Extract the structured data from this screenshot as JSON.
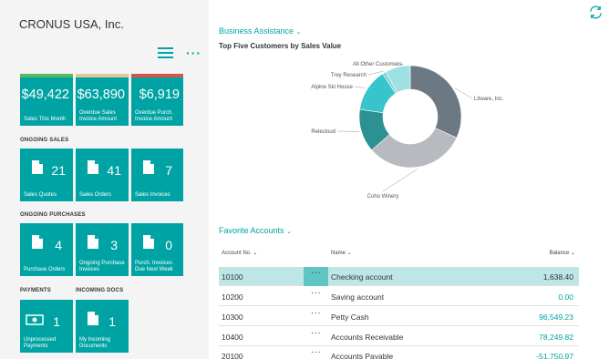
{
  "header": {
    "company": "CRONUS USA, Inc."
  },
  "kpi_tiles": [
    {
      "value": "$49,422",
      "caption": "Sales This Month",
      "bar_color": "#5cb85c"
    },
    {
      "value": "$63,890",
      "caption": "Overdue Sales Invoice Amount",
      "bar_color": "#e2c792"
    },
    {
      "value": "$6,919",
      "caption": "Overdue Purch. Invoice Amount",
      "bar_color": "#d9534f"
    }
  ],
  "sections": {
    "ongoing_sales": "ONGOING SALES",
    "ongoing_purchases": "ONGOING PURCHASES",
    "payments": "PAYMENTS",
    "incoming_docs": "INCOMING DOCS"
  },
  "sales_tiles": [
    {
      "count": "21",
      "caption": "Sales Quotes"
    },
    {
      "count": "41",
      "caption": "Sales Orders"
    },
    {
      "count": "7",
      "caption": "Sales Invoices"
    }
  ],
  "purchase_tiles": [
    {
      "count": "4",
      "caption": "Purchase Orders"
    },
    {
      "count": "3",
      "caption": "Ongoing Purchase Invoices"
    },
    {
      "count": "0",
      "caption": "Purch. Invoices Due Next Week"
    }
  ],
  "payment_tile": {
    "count": "1",
    "caption": "Unprocessed Payments"
  },
  "incoming_tile": {
    "count": "1",
    "caption": "My Incoming Documents"
  },
  "business_assistance": {
    "title": "Business Assistance",
    "chevron": "chevron-down-icon"
  },
  "chart_data": {
    "type": "pie",
    "title": "Top Five Customers by Sales Value",
    "categories": [
      "Litware, Inc.",
      "Coho Winery",
      "Relecloud",
      "Alpine Ski House",
      "Trey Research",
      "All Other Customers"
    ],
    "values": [
      28,
      28,
      12,
      12,
      1,
      7
    ],
    "colors": [
      "#6c7882",
      "#b7bbc0",
      "#2b9191",
      "#38c4cb",
      "#7ed5da",
      "#9fe0e3"
    ],
    "donut": true
  },
  "favorite_accounts": {
    "title": "Favorite Accounts",
    "columns": {
      "no": "Account No.",
      "name": "Name",
      "balance": "Balance"
    },
    "rows": [
      {
        "no": "10100",
        "name": "Checking account",
        "balance": "1,638.40",
        "selected": true
      },
      {
        "no": "10200",
        "name": "Saving account",
        "balance": "0.00"
      },
      {
        "no": "10300",
        "name": "Petty Cash",
        "balance": "96,549.23"
      },
      {
        "no": "10400",
        "name": "Accounts Receivable",
        "balance": "78,249.82"
      },
      {
        "no": "20100",
        "name": "Accounts Payable",
        "balance": "-51,750.97"
      }
    ],
    "dots": "···"
  }
}
